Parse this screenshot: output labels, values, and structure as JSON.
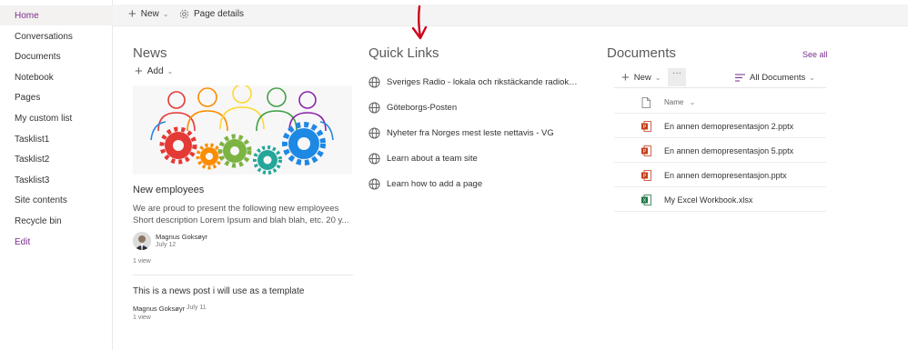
{
  "nav": {
    "items": [
      {
        "label": "Home"
      },
      {
        "label": "Conversations"
      },
      {
        "label": "Documents"
      },
      {
        "label": "Notebook"
      },
      {
        "label": "Pages"
      },
      {
        "label": "My custom list"
      },
      {
        "label": "Tasklist1"
      },
      {
        "label": "Tasklist2"
      },
      {
        "label": "Tasklist3"
      },
      {
        "label": "Site contents"
      },
      {
        "label": "Recycle bin"
      },
      {
        "label": "Edit"
      }
    ]
  },
  "commandbar": {
    "new_label": "New",
    "page_details_label": "Page details"
  },
  "news": {
    "title": "News",
    "add_label": "Add",
    "posts": [
      {
        "title": "New employees",
        "desc_line1": "We are proud to present the following new employees",
        "desc_line2": "Short description Lorem Ipsum and blah blah, etc. 20 y...",
        "author": "Magnus Goksøyr",
        "date": "July 12",
        "views": "1 view"
      },
      {
        "title": "This is a news post i will use as a template",
        "author": "Magnus Goksøyr",
        "date": "July 11",
        "views": "1 view"
      }
    ]
  },
  "quicklinks": {
    "title": "Quick Links",
    "items": [
      {
        "label": "Sveriges Radio - lokala och rikstäckande radioka...",
        "icon": "globe-icon"
      },
      {
        "label": "Göteborgs-Posten",
        "icon": "globe-icon"
      },
      {
        "label": "Nyheter fra Norges mest leste nettavis - VG",
        "icon": "globe-icon"
      },
      {
        "label": "Learn about a team site",
        "icon": "globe-icon"
      },
      {
        "label": "Learn how to add a page",
        "icon": "globe-icon"
      }
    ]
  },
  "documents": {
    "title": "Documents",
    "see_all_label": "See all",
    "new_label": "New",
    "more_label": "···",
    "view_label": "All Documents",
    "column_name": "Name",
    "files": [
      {
        "name": "En annen demopresentasjon 2.pptx",
        "icon": "powerpoint-icon"
      },
      {
        "name": "En annen demopresentasjon 5.pptx",
        "icon": "powerpoint-icon"
      },
      {
        "name": "En annen demopresentasjon.pptx",
        "icon": "powerpoint-icon"
      },
      {
        "name": "My Excel Workbook.xlsx",
        "icon": "excel-icon"
      }
    ]
  },
  "colors": {
    "accent": "#7a2d8c",
    "annotation_arrow": "#d0021b",
    "powerpoint": "#c43e1c",
    "excel": "#1f7244"
  }
}
